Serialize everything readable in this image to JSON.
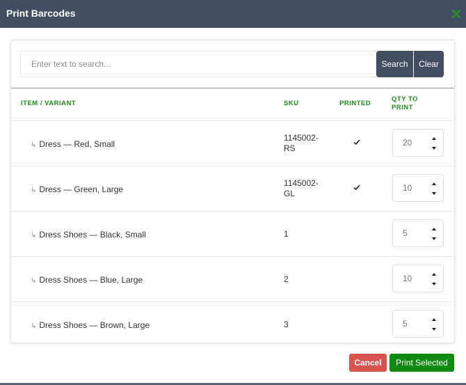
{
  "modal": {
    "title": "Print Barcodes",
    "close_icon": "close-x-icon",
    "accent_green": "#1f8c1f",
    "header_color": "#434d62"
  },
  "search": {
    "placeholder": "Enter text to search...",
    "value": "",
    "search_label": "Search",
    "clear_label": "Clear"
  },
  "table": {
    "columns": {
      "item": "ITEM / VARIANT",
      "sku": "SKU",
      "printed": "PRINTED",
      "qty": "QTY TO PRINT"
    },
    "rows": [
      {
        "item": "Dress — Red, Small",
        "sku": "1145002-RS",
        "sku_lines": [
          "1145002-",
          "RS"
        ],
        "printed": true,
        "qty": "20"
      },
      {
        "item": "Dress — Green, Large",
        "sku": "1145002-GL",
        "sku_lines": [
          "1145002-",
          "GL"
        ],
        "printed": true,
        "qty": "10"
      },
      {
        "item": "Dress Shoes — Black, Small",
        "sku": "1",
        "sku_lines": [
          "1"
        ],
        "printed": false,
        "qty": "5"
      },
      {
        "item": "Dress Shoes — Blue, Large",
        "sku": "2",
        "sku_lines": [
          "2"
        ],
        "printed": false,
        "qty": "10"
      },
      {
        "item": "Dress Shoes — Brown, Large",
        "sku": "3",
        "sku_lines": [
          "3"
        ],
        "printed": false,
        "qty": "5"
      }
    ]
  },
  "footer": {
    "cancel_label": "Cancel",
    "print_label": "Print Selected",
    "cancel_color": "#d9534f",
    "print_color": "#108a10"
  }
}
